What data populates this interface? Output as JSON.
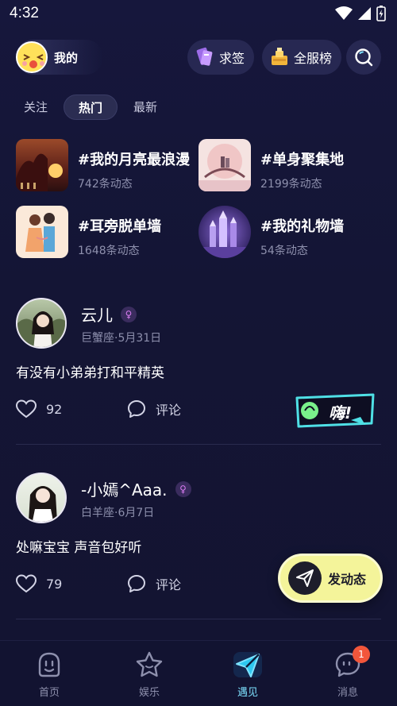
{
  "status_bar": {
    "time": "4:32"
  },
  "header": {
    "me_label": "我的",
    "qiuqian_label": "求签",
    "ranking_label": "全服榜"
  },
  "tabs": [
    {
      "label": "关注"
    },
    {
      "label": "热门",
      "active": true
    },
    {
      "label": "最新"
    }
  ],
  "topics": [
    {
      "title": "#我的月亮最浪漫",
      "count": "742条动态"
    },
    {
      "title": "#单身聚集地",
      "count": "2199条动态"
    },
    {
      "title": "#耳旁脱单墙",
      "count": "1648条动态"
    },
    {
      "title": "#我的礼物墙",
      "count": "54条动态"
    }
  ],
  "posts": [
    {
      "name": "云儿",
      "meta": "巨蟹座·5月31日",
      "content": "有没有小弟弟打和平精英",
      "likes": "92",
      "comment_label": "评论",
      "badge_text": "嗨!"
    },
    {
      "name": "-小嫣^Aaa.",
      "meta": "白羊座·6月7日",
      "content": "处嘛宝宝 声音包好听",
      "likes": "79",
      "comment_label": "评论"
    }
  ],
  "publish": {
    "label": "发动态"
  },
  "bottom_nav": [
    {
      "label": "首页",
      "icon": "home-icon"
    },
    {
      "label": "娱乐",
      "icon": "star-icon"
    },
    {
      "label": "遇见",
      "icon": "send-icon",
      "active": true
    },
    {
      "label": "消息",
      "icon": "chat-icon",
      "badge": "1"
    }
  ],
  "colors": {
    "background": "#16173c",
    "accent_active": "#7ee2ff",
    "publish_button": "#f4f49a",
    "badge": "#f2563b"
  }
}
